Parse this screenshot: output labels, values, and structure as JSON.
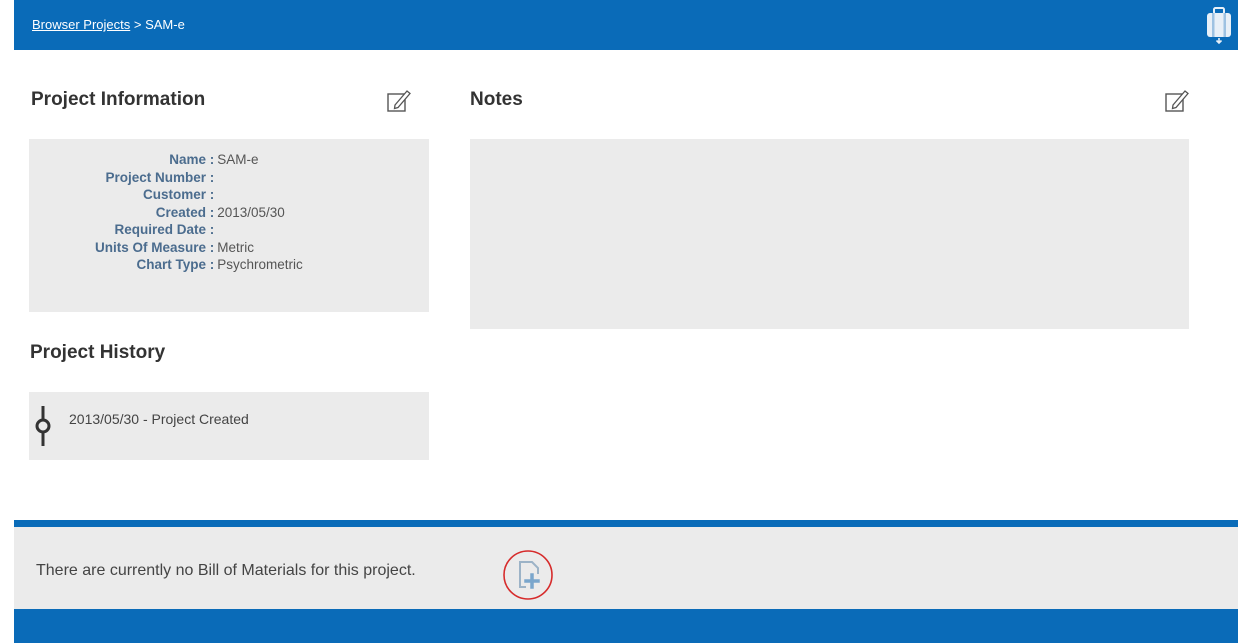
{
  "breadcrumb": {
    "link": "Browser Projects",
    "separator": ">",
    "current": "SAM-e"
  },
  "project_info": {
    "title": "Project Information",
    "fields": [
      {
        "label": "Name",
        "value": "SAM-e"
      },
      {
        "label": "Project Number",
        "value": ""
      },
      {
        "label": "Customer",
        "value": ""
      },
      {
        "label": "Created",
        "value": "2013/05/30"
      },
      {
        "label": "Required Date",
        "value": ""
      },
      {
        "label": "Units Of Measure",
        "value": "Metric"
      },
      {
        "label": "Chart Type",
        "value": "Psychrometric"
      }
    ]
  },
  "notes": {
    "title": "Notes"
  },
  "history": {
    "title": "Project History",
    "items": [
      {
        "text": "2013/05/30 - Project Created"
      }
    ]
  },
  "bom": {
    "empty_message": "There are currently no Bill of Materials for this project."
  },
  "icons": {
    "edit": "edit-icon",
    "briefcase": "briefcase-download-icon",
    "timeline": "timeline-node-icon",
    "add_document": "add-document-icon"
  },
  "colors": {
    "header": "#0a6bb8",
    "panel": "#ebebeb",
    "label": "#4b6c8e",
    "highlight": "#d62b2b"
  }
}
